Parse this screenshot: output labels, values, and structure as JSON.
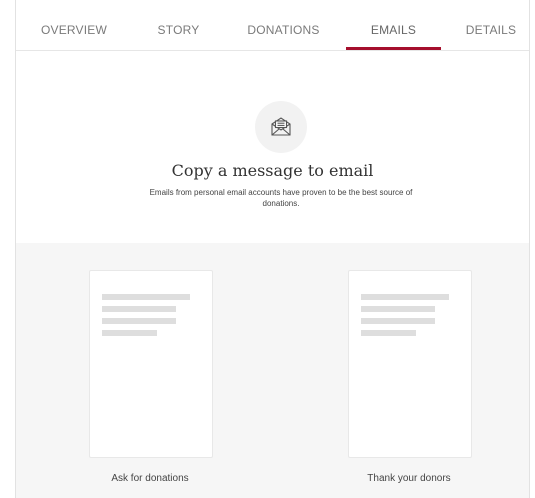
{
  "tabs": [
    {
      "label": "OVERVIEW"
    },
    {
      "label": "STORY"
    },
    {
      "label": "DONATIONS"
    },
    {
      "label": "EMAILS"
    },
    {
      "label": "DETAILS"
    }
  ],
  "active_tab": "EMAILS",
  "hero": {
    "icon": "envelope-icon",
    "title": "Copy a message to email",
    "description": "Emails from personal email accounts have proven to be the best source of donations."
  },
  "templates": [
    {
      "label": "Ask for donations"
    },
    {
      "label": "Thank your donors"
    }
  ],
  "colors": {
    "accent": "#a50f2d",
    "section_background": "#f6f6f6",
    "placeholder_line": "#dedede"
  }
}
